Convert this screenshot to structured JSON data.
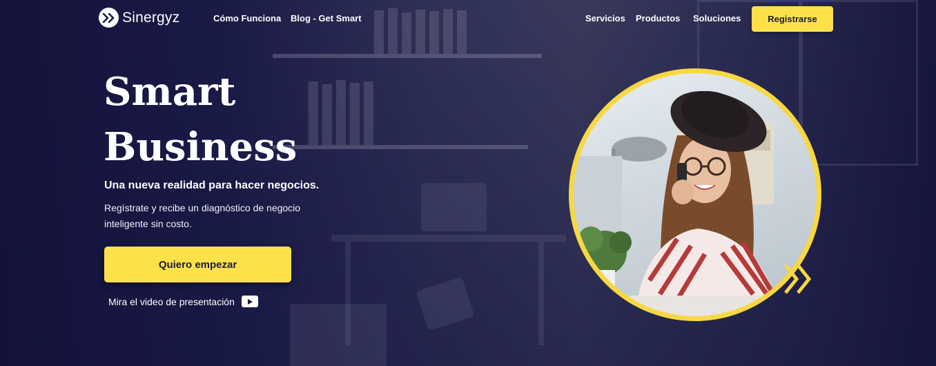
{
  "brand": {
    "name": "Sinergyz",
    "logo_icon": "double-chevron-right-icon"
  },
  "nav": {
    "left_links": [
      "Cómo Funciona",
      "Blog - Get Smart"
    ],
    "right_links": [
      "Servicios",
      "Productos",
      "Soluciones"
    ],
    "register_label": "Registrarse"
  },
  "hero": {
    "title_line1": "Smart",
    "title_line2": "Business",
    "subtitle": "Una nueva realidad para hacer negocios.",
    "description": "Regístrate y recibe un diagnóstico de negocio inteligente sin costo.",
    "cta_label": "Quiero empezar",
    "video_label": "Mira el video de presentación",
    "video_icon": "play-icon"
  },
  "colors": {
    "accent": "#fde14b",
    "ring": "#f7d842",
    "background": "#15163a",
    "button_text": "#1d1b3a"
  }
}
